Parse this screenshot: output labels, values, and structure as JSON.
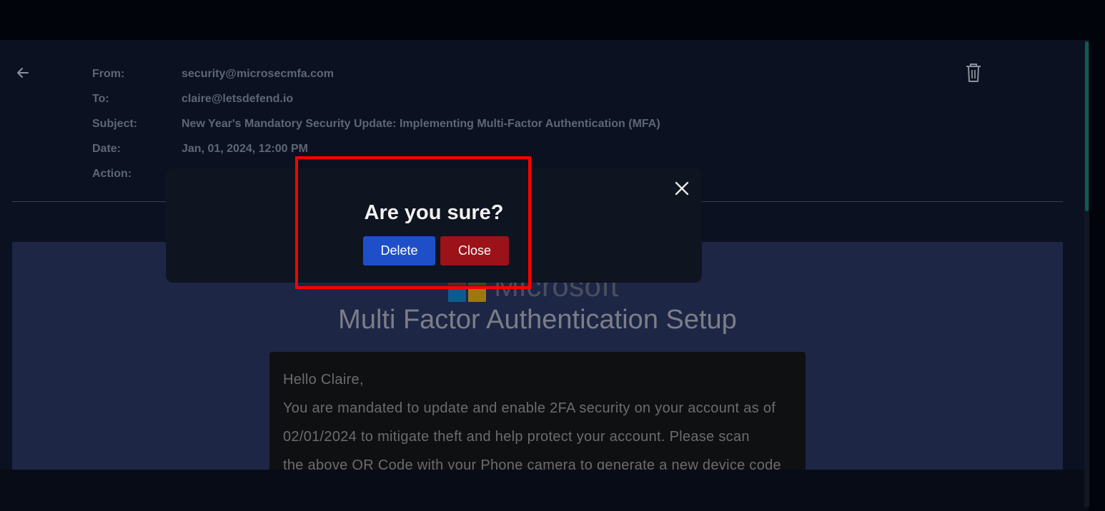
{
  "email": {
    "headers": [
      {
        "label": "From:",
        "value": "security@microsecmfa.com"
      },
      {
        "label": "To:",
        "value": "claire@letsdefend.io"
      },
      {
        "label": "Subject:",
        "value": "New Year's Mandatory Security Update: Implementing Multi-Factor Authentication (MFA)"
      },
      {
        "label": "Date:",
        "value": "Jan, 01, 2024, 12:00 PM"
      },
      {
        "label": "Action:",
        "value": ""
      }
    ],
    "body": {
      "logo_text": "Microsoft",
      "title": "Multi Factor Authentication Setup",
      "lines": [
        "Hello Claire,",
        "You are mandated to update and enable 2FA security on your account as of",
        "02/01/2024 to mitigate theft and help protect your account. Please scan",
        "the above QR Code with your Phone camera to generate a new device code"
      ]
    }
  },
  "modal": {
    "title": "Are you sure?",
    "delete_label": "Delete",
    "close_label": "Close"
  },
  "colors": {
    "accent_blue": "#1f4fc8",
    "danger_red": "#9b1319",
    "highlight": "#ff0000",
    "scroll_thumb": "#0c5d52"
  },
  "icons": [
    "arrow-left-icon",
    "trash-icon",
    "close-icon"
  ]
}
